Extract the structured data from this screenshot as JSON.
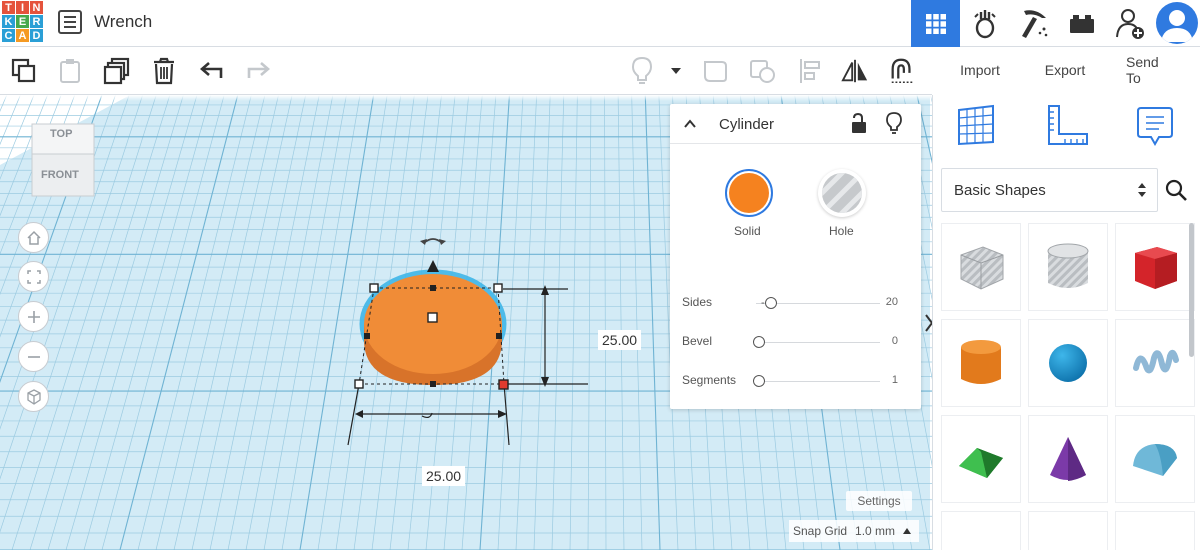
{
  "app": {
    "logo_letters": [
      "T",
      "I",
      "N",
      "K",
      "E",
      "R",
      "C",
      "A",
      "D"
    ],
    "design_title": "Wrench"
  },
  "topnav": {
    "icons": [
      "grid-view-icon",
      "circuits-icon",
      "codeblocks-icon",
      "bricks-icon",
      "add-user-icon"
    ],
    "active": "grid-view-icon"
  },
  "toolbar": {
    "import_label": "Import",
    "export_label": "Export",
    "send_to_label": "Send To"
  },
  "inspector": {
    "shape_name": "Cylinder",
    "solid_label": "Solid",
    "hole_label": "Hole",
    "solid_color": "#f5821f",
    "params": [
      {
        "label": "Sides",
        "value": "20",
        "position": 0.0
      },
      {
        "label": "Bevel",
        "value": "0",
        "position": 0.0
      },
      {
        "label": "Segments",
        "value": "1",
        "position": 0.0
      }
    ]
  },
  "viewcube": {
    "top_label": "TOP",
    "front_label": "FRONT"
  },
  "dimensions": {
    "height_value": "25.00",
    "width_value": "25.00"
  },
  "rightpanel": {
    "category_selected": "Basic Shapes",
    "shapes": [
      "box-hole",
      "cylinder-hole",
      "box",
      "cylinder",
      "sphere",
      "scribble",
      "roof",
      "cone",
      "round-roof"
    ]
  },
  "bottom": {
    "settings_label": "Settings",
    "snap_grid_label": "Snap Grid",
    "snap_grid_value": "1.0 mm"
  },
  "colors": {
    "accent": "#2f7ae0",
    "grid_bg": "#cfe8f3",
    "grid_line": "#8fc5dd",
    "selection_outline": "#3fb6e8",
    "orange": "#f5821f"
  }
}
